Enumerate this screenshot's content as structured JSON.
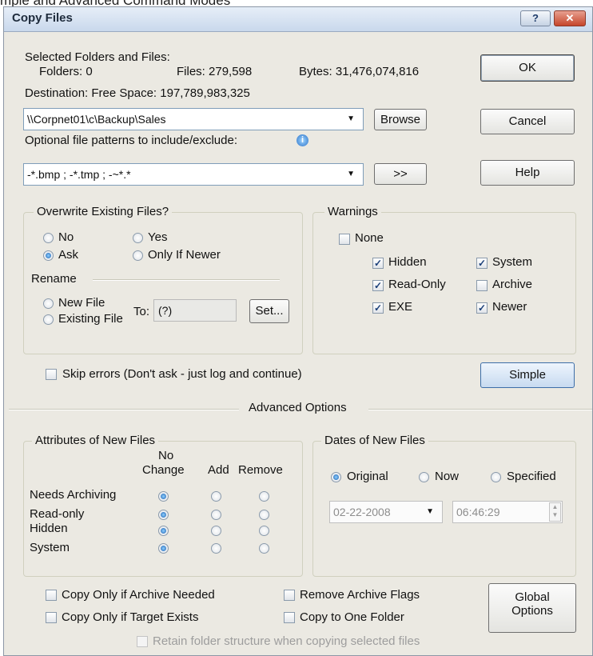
{
  "top_caption": "mple and Advanced Command Modes",
  "window": {
    "title": "Copy Files",
    "help_label": "?",
    "close_label": "✕"
  },
  "selection": {
    "heading": "Selected Folders and Files:",
    "folders": "Folders:  0",
    "files": "Files:  279,598",
    "bytes": "Bytes:  31,476,074,816"
  },
  "destination": {
    "label": "Destination:   Free Space:    197,789,983,325",
    "value": "\\\\Corpnet01\\c\\Backup\\Sales",
    "browse_label": "Browse"
  },
  "patterns": {
    "label": "Optional file patterns to include/exclude:",
    "value": "-*.bmp ; -*.tmp ; -~*.*",
    "more_label": ">>"
  },
  "buttons": {
    "ok": "OK",
    "cancel": "Cancel",
    "help": "Help",
    "simple": "Simple"
  },
  "overwrite": {
    "title": "Overwrite Existing Files?",
    "no": "No",
    "yes": "Yes",
    "ask": "Ask",
    "only_if_newer": "Only If Newer",
    "selected": "ask",
    "rename_label": "Rename",
    "new_file": "New File",
    "existing_file": "Existing File",
    "to_label": "To:",
    "to_value": "(?)",
    "set_label": "Set..."
  },
  "warnings": {
    "title": "Warnings",
    "none": "None",
    "hidden": "Hidden",
    "system": "System",
    "read_only": "Read-Only",
    "archive": "Archive",
    "exe": "EXE",
    "newer": "Newer",
    "checked": {
      "none": false,
      "hidden": true,
      "system": true,
      "read_only": true,
      "archive": false,
      "exe": true,
      "newer": true
    }
  },
  "skip_errors": {
    "label": "Skip errors (Don't ask - just log and continue)",
    "checked": false
  },
  "advanced_label": "Advanced Options",
  "attributes": {
    "title": "Attributes of New Files",
    "col_no_change": "No\nChange",
    "col_no": "No",
    "col_change": "Change",
    "col_add": "Add",
    "col_remove": "Remove",
    "rows": [
      "Needs Archiving",
      "Read-only",
      "Hidden",
      "System"
    ],
    "selected_column": "no_change"
  },
  "dates": {
    "title": "Dates of New Files",
    "original": "Original",
    "now": "Now",
    "specified": "Specified",
    "selected": "original",
    "date_value": "02-22-2008",
    "time_value": "06:46:29"
  },
  "bottom": {
    "copy_only_archive": "Copy Only if Archive Needed",
    "copy_only_target": "Copy Only if Target Exists",
    "remove_archive": "Remove Archive Flags",
    "copy_one_folder": "Copy to One Folder",
    "retain_structure": "Retain folder structure when copying selected files",
    "global_options_1": "Global",
    "global_options_2": "Options"
  }
}
